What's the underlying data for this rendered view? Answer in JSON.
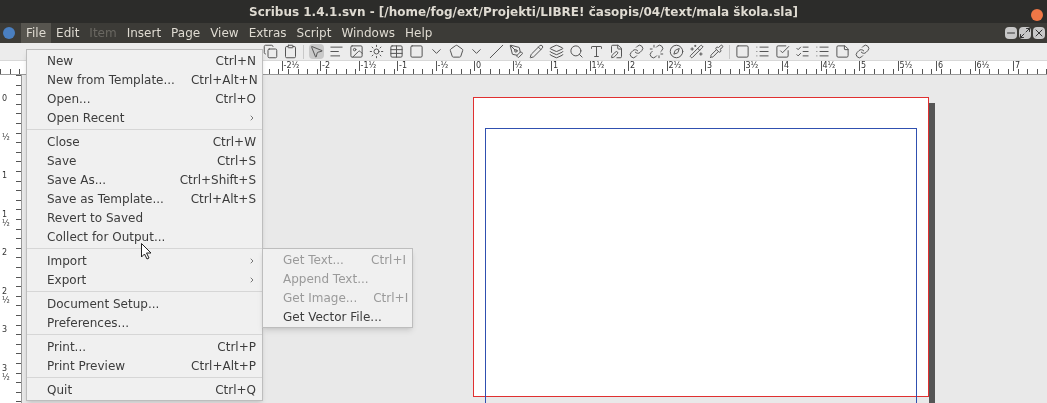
{
  "window": {
    "title": "Scribus 1.4.1.svn - [/home/fog/ext/Projekti/LIBRE! časopis/04/text/mala škola.sla]"
  },
  "menubar": [
    {
      "label": "File",
      "selected": true,
      "disabled": false
    },
    {
      "label": "Edit",
      "selected": false,
      "disabled": false
    },
    {
      "label": "Item",
      "selected": false,
      "disabled": true
    },
    {
      "label": "Insert",
      "selected": false,
      "disabled": false
    },
    {
      "label": "Page",
      "selected": false,
      "disabled": false
    },
    {
      "label": "View",
      "selected": false,
      "disabled": false
    },
    {
      "label": "Extras",
      "selected": false,
      "disabled": false
    },
    {
      "label": "Script",
      "selected": false,
      "disabled": false
    },
    {
      "label": "Windows",
      "selected": false,
      "disabled": false
    },
    {
      "label": "Help",
      "selected": false,
      "disabled": false
    }
  ],
  "file_menu": [
    [
      {
        "label": "New",
        "shortcut": "Ctrl+N",
        "submenu": false
      },
      {
        "label": "New from Template...",
        "shortcut": "Ctrl+Alt+N",
        "submenu": false
      },
      {
        "label": "Open...",
        "shortcut": "Ctrl+O",
        "submenu": false
      },
      {
        "label": "Open Recent",
        "submenu": true
      }
    ],
    [
      {
        "label": "Close",
        "shortcut": "Ctrl+W",
        "submenu": false
      },
      {
        "label": "Save",
        "shortcut": "Ctrl+S",
        "submenu": false
      },
      {
        "label": "Save As...",
        "shortcut": "Ctrl+Shift+S",
        "submenu": false
      },
      {
        "label": "Save as Template...",
        "shortcut": "Ctrl+Alt+S",
        "submenu": false
      },
      {
        "label": "Revert to Saved",
        "submenu": false
      },
      {
        "label": "Collect for Output...",
        "submenu": false
      }
    ],
    [
      {
        "label": "Import",
        "submenu": true
      },
      {
        "label": "Export",
        "submenu": true
      }
    ],
    [
      {
        "label": "Document Setup...",
        "submenu": false
      },
      {
        "label": "Preferences...",
        "submenu": false
      }
    ],
    [
      {
        "label": "Print...",
        "shortcut": "Ctrl+P",
        "submenu": false
      },
      {
        "label": "Print Preview",
        "shortcut": "Ctrl+Alt+P",
        "submenu": false
      }
    ],
    [
      {
        "label": "Quit",
        "shortcut": "Ctrl+Q",
        "submenu": false
      }
    ]
  ],
  "import_submenu": [
    {
      "label": "Get Text...",
      "shortcut": "Ctrl+I",
      "disabled": true
    },
    {
      "label": "Append Text...",
      "disabled": true
    },
    {
      "label": "Get Image...",
      "shortcut": "Ctrl+I",
      "disabled": true
    },
    {
      "label": "Get Vector File...",
      "disabled": false
    }
  ],
  "horizontal_ruler": [
    "-2½",
    "-2",
    "-1½",
    "-1",
    "-½",
    "0",
    "½",
    "1",
    "1½",
    "2",
    "2½",
    "3",
    "3½",
    "4",
    "4½",
    "5",
    "5½",
    "6",
    "6½",
    "7"
  ],
  "vertical_ruler": [
    "0",
    "½",
    "1",
    "1½",
    "2",
    "2½",
    "3",
    "3½"
  ]
}
